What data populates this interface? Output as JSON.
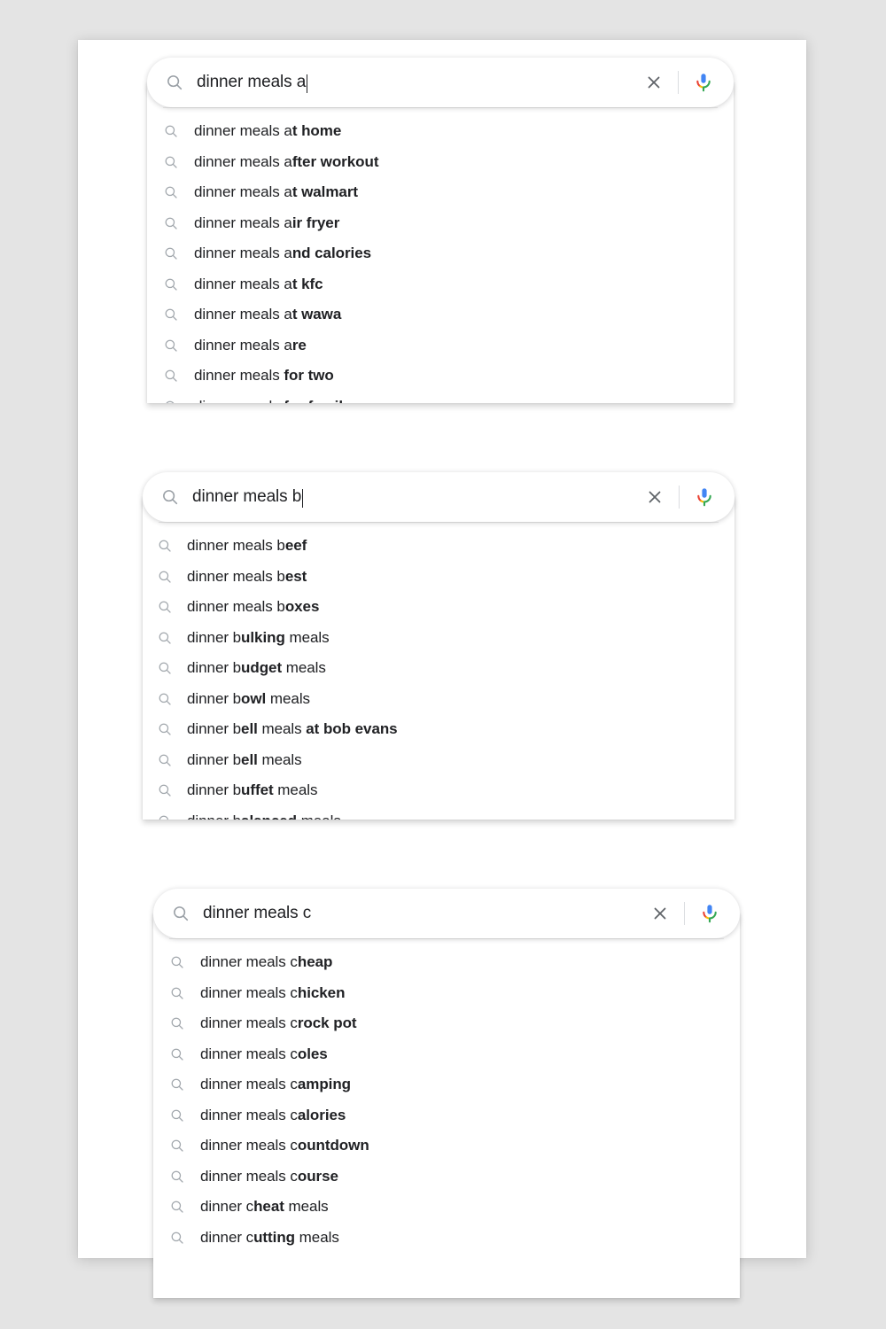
{
  "background_color": "#e4e4e4",
  "sheet_color": "#ffffff",
  "icons": {
    "search": "search-icon",
    "clear": "close-icon",
    "mic": "microphone-icon"
  },
  "colors": {
    "text": "#202124",
    "icon_gray": "#9aa0a6",
    "mic_blue": "#4285F4",
    "mic_red": "#EA4335",
    "mic_yellow": "#FBBC05",
    "mic_green": "#34A853",
    "divider": "#dadce0"
  },
  "search_widgets": [
    {
      "id": "widget-a",
      "input": {
        "value": "dinner meals a",
        "placeholder": "Search",
        "caret_visible": true
      },
      "suggestions": [
        {
          "plain": "dinner meals a",
          "bold": "t home"
        },
        {
          "plain": "dinner meals a",
          "bold": "fter workout"
        },
        {
          "plain": "dinner meals a",
          "bold": "t walmart"
        },
        {
          "plain": "dinner meals a",
          "bold": "ir fryer"
        },
        {
          "plain": "dinner meals a",
          "bold": "nd calories"
        },
        {
          "plain": "dinner meals a",
          "bold": "t kfc"
        },
        {
          "plain": "dinner meals a",
          "bold": "t wawa"
        },
        {
          "plain": "dinner meals a",
          "bold": "re"
        },
        {
          "plain": "dinner meals ",
          "bold": "for two"
        },
        {
          "plain": "dinner meals ",
          "bold": "for family"
        }
      ]
    },
    {
      "id": "widget-b",
      "input": {
        "value": "dinner meals b",
        "placeholder": "Search",
        "caret_visible": true
      },
      "suggestions": [
        {
          "plain": "dinner meals b",
          "bold": "eef"
        },
        {
          "plain": "dinner meals b",
          "bold": "est"
        },
        {
          "plain": "dinner meals b",
          "bold": "oxes"
        },
        {
          "plain": "dinner b",
          "bold": "ulking",
          "tail": " meals"
        },
        {
          "plain": "dinner b",
          "bold": "udget",
          "tail": " meals"
        },
        {
          "plain": "dinner b",
          "bold": "owl",
          "tail": " meals"
        },
        {
          "plain": "dinner b",
          "bold": "ell",
          "tail": " meals ",
          "bold2": "at bob evans"
        },
        {
          "plain": "dinner b",
          "bold": "ell",
          "tail": " meals"
        },
        {
          "plain": "dinner b",
          "bold": "uffet",
          "tail": " meals"
        },
        {
          "plain": "dinner b",
          "bold": "alanced",
          "tail": " meals"
        }
      ]
    },
    {
      "id": "widget-c",
      "input": {
        "value": "dinner meals c",
        "placeholder": "Search",
        "caret_visible": false
      },
      "suggestions": [
        {
          "plain": "dinner meals c",
          "bold": "heap"
        },
        {
          "plain": "dinner meals c",
          "bold": "hicken"
        },
        {
          "plain": "dinner meals c",
          "bold": "rock pot"
        },
        {
          "plain": "dinner meals c",
          "bold": "oles"
        },
        {
          "plain": "dinner meals c",
          "bold": "amping"
        },
        {
          "plain": "dinner meals c",
          "bold": "alories"
        },
        {
          "plain": "dinner meals c",
          "bold": "ountdown"
        },
        {
          "plain": "dinner meals c",
          "bold": "ourse"
        },
        {
          "plain": "dinner c",
          "bold": "heat",
          "tail": " meals"
        },
        {
          "plain": "dinner c",
          "bold": "utting",
          "tail": " meals"
        }
      ]
    }
  ]
}
